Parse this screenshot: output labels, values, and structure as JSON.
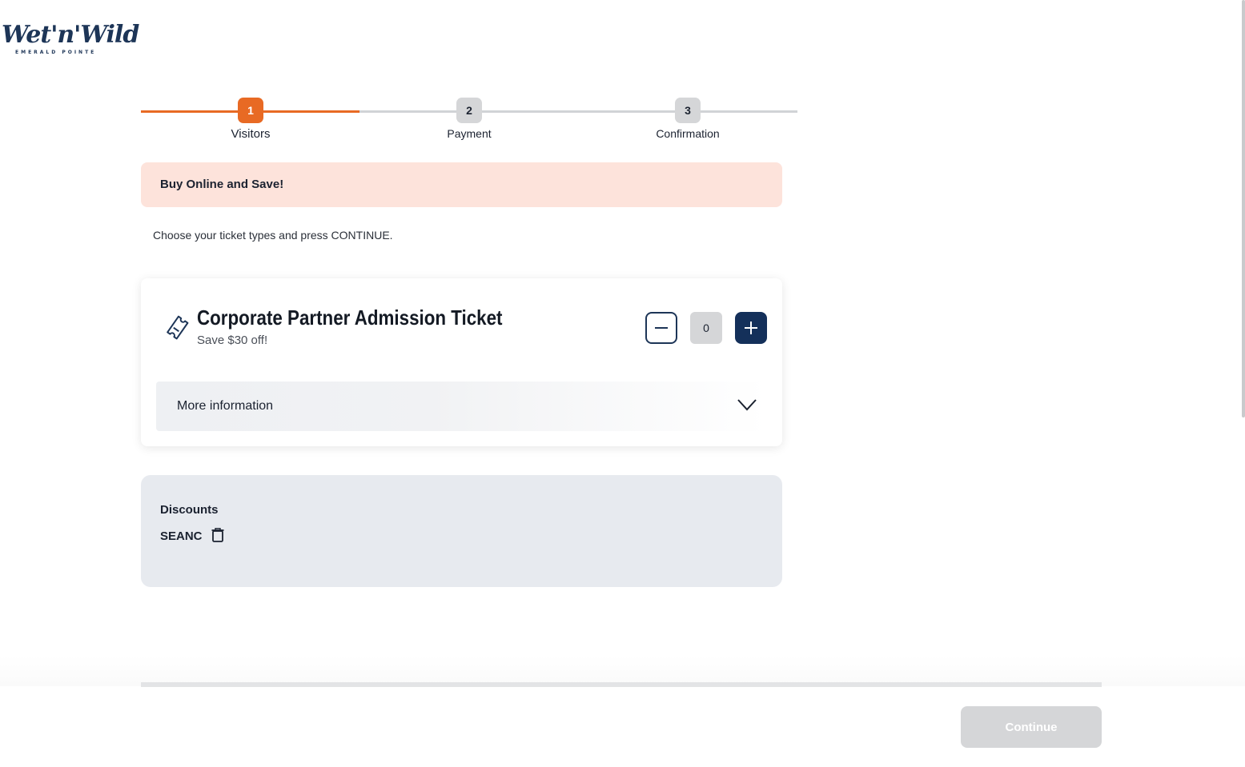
{
  "brand": {
    "logo_word": "Wet'n'Wild",
    "logo_sub": "EMERALD POINTE"
  },
  "colors": {
    "accent": "#e86a24",
    "navy": "#14305a",
    "promo_bg": "#fde3db",
    "discount_bg": "#e7eaef",
    "disabled": "#d5d6d8"
  },
  "stepper": {
    "steps": [
      {
        "number": "1",
        "label": "Visitors",
        "state": "active"
      },
      {
        "number": "2",
        "label": "Payment",
        "state": "pending"
      },
      {
        "number": "3",
        "label": "Confirmation",
        "state": "pending"
      }
    ]
  },
  "promo": {
    "text": "Buy Online and Save!"
  },
  "instructions": "Choose your ticket types and press CONTINUE.",
  "ticket": {
    "title": "Corporate Partner Admission Ticket",
    "subtitle": "Save $30 off!",
    "quantity": "0",
    "icon": "ticket-icon",
    "more_info_label": "More information"
  },
  "discounts": {
    "title": "Discounts",
    "code": "SEANC"
  },
  "footer": {
    "continue_label": "Continue"
  }
}
